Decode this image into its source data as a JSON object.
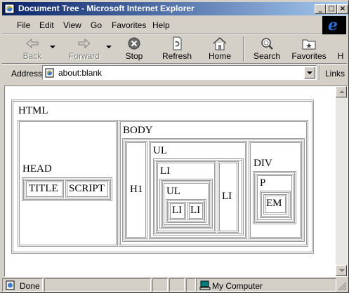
{
  "window": {
    "title": "Document Tree - Microsoft Internet Explorer",
    "controls": {
      "minimize": "_",
      "maximize": "□",
      "close": "×"
    }
  },
  "menu": {
    "items": [
      {
        "label": "File"
      },
      {
        "label": "Edit"
      },
      {
        "label": "View"
      },
      {
        "label": "Go"
      },
      {
        "label": "Favorites"
      },
      {
        "label": "Help"
      }
    ]
  },
  "toolbar": {
    "back": "Back",
    "forward": "Forward",
    "stop": "Stop",
    "refresh": "Refresh",
    "home": "Home",
    "search": "Search",
    "favorites": "Favorites",
    "more": "H"
  },
  "address": {
    "label": "Address",
    "value": "about:blank",
    "links": "Links"
  },
  "tree": {
    "html": "HTML",
    "head": "HEAD",
    "title": "TITLE",
    "script": "SCRIPT",
    "body": "BODY",
    "h1": "H1",
    "ul_outer": "UL",
    "li_outer": "LI",
    "ul_inner": "UL",
    "li_inner_1": "LI",
    "li_inner_2": "LI",
    "li_side": "LI",
    "div": "DIV",
    "p": "P",
    "em": "EM"
  },
  "status": {
    "left": "Done",
    "zone": "My Computer"
  },
  "colors": {
    "titlebar_start": "#0a246a",
    "titlebar_end": "#a6caf0",
    "chrome": "#d4d0c8",
    "box_border": "#9a9a9a"
  }
}
